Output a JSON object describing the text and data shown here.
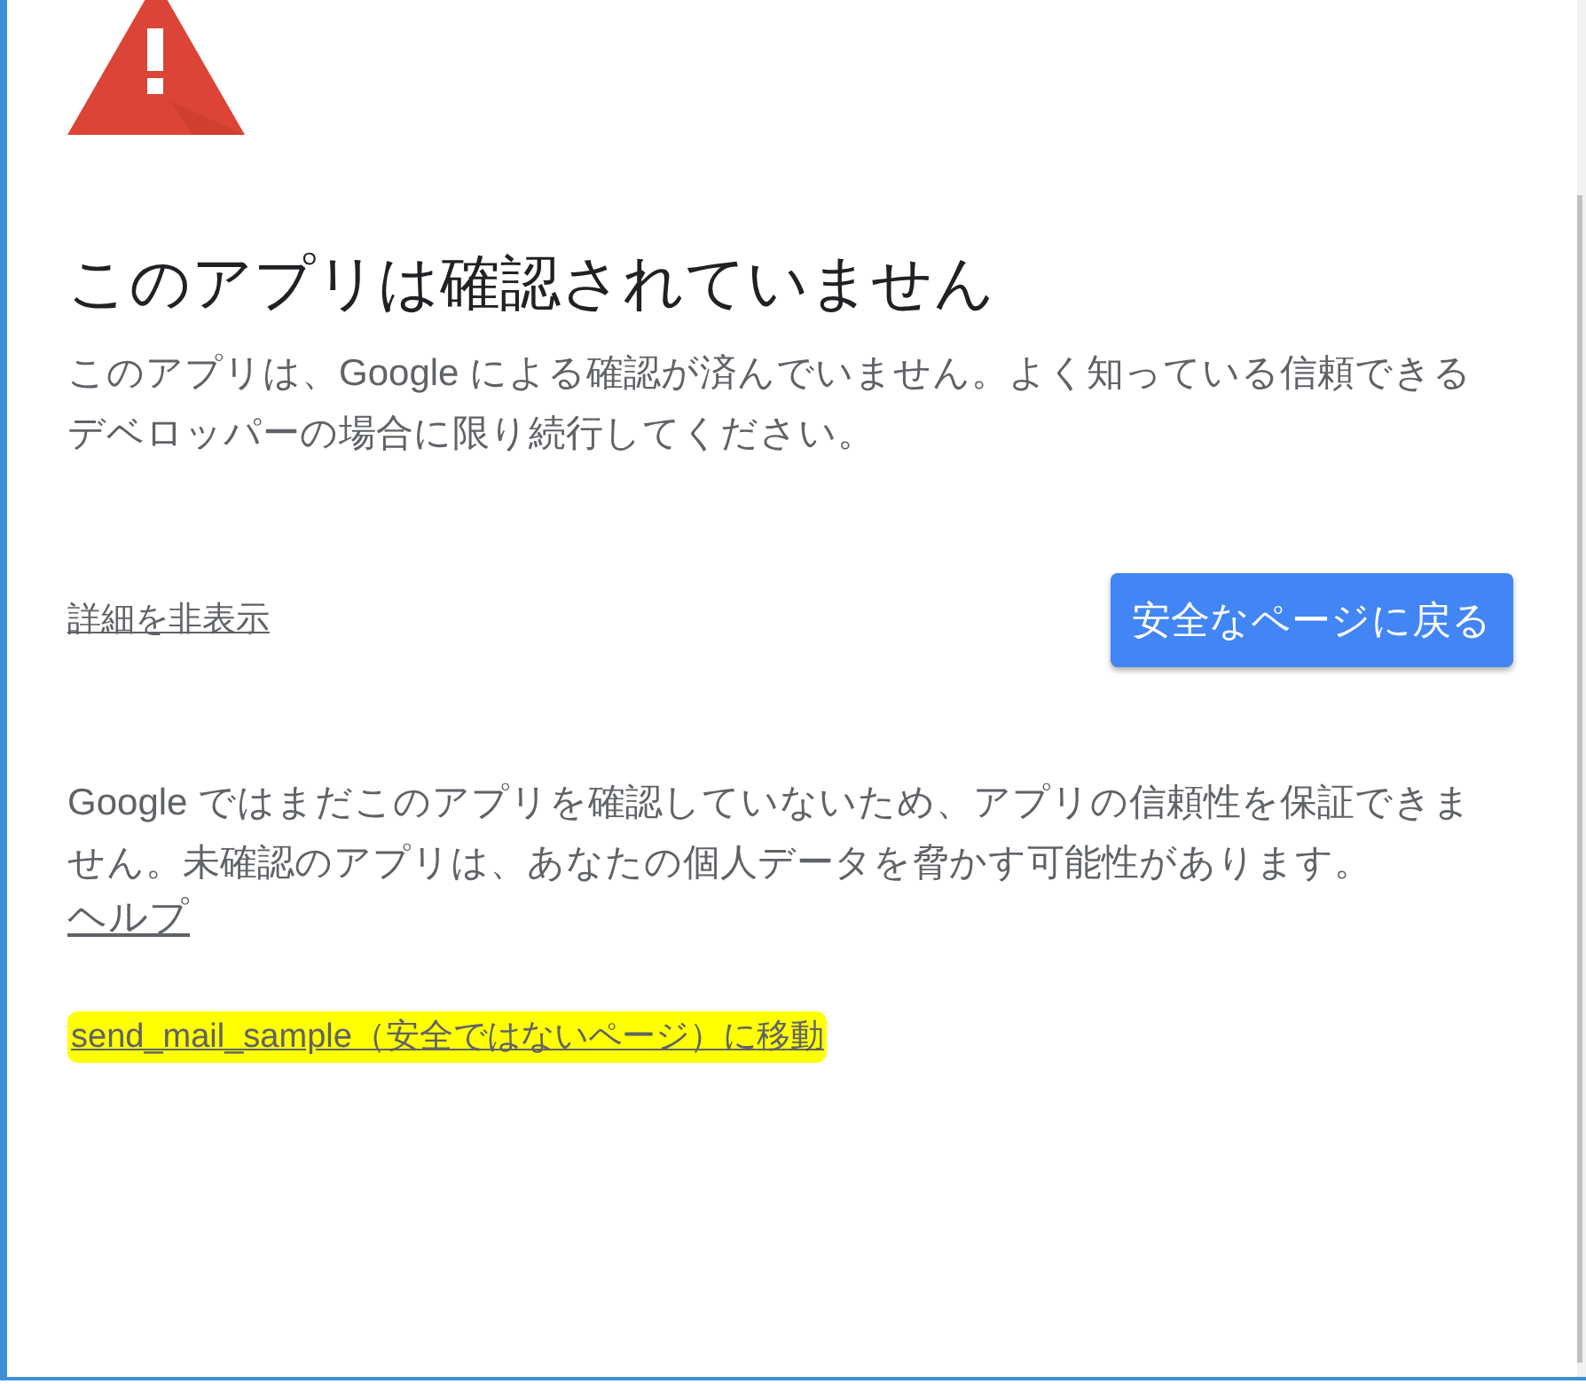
{
  "title": "このアプリは確認されていません",
  "description": "このアプリは、Google による確認が済んでいません。よく知っている信頼できるデベロッパーの場合に限り続行してください。",
  "details_link": "詳細を非表示",
  "back_button": "安全なページに戻る",
  "details_text": "Google ではまだこのアプリを確認していないため、アプリの信頼性を保証できません。未確認のアプリは、あなたの個人データを脅かす可能性があります。",
  "help_link": "ヘルプ",
  "proceed_link": {
    "text": "send_mail_sample（安全ではないページ）に移動",
    "highlighted": true
  }
}
